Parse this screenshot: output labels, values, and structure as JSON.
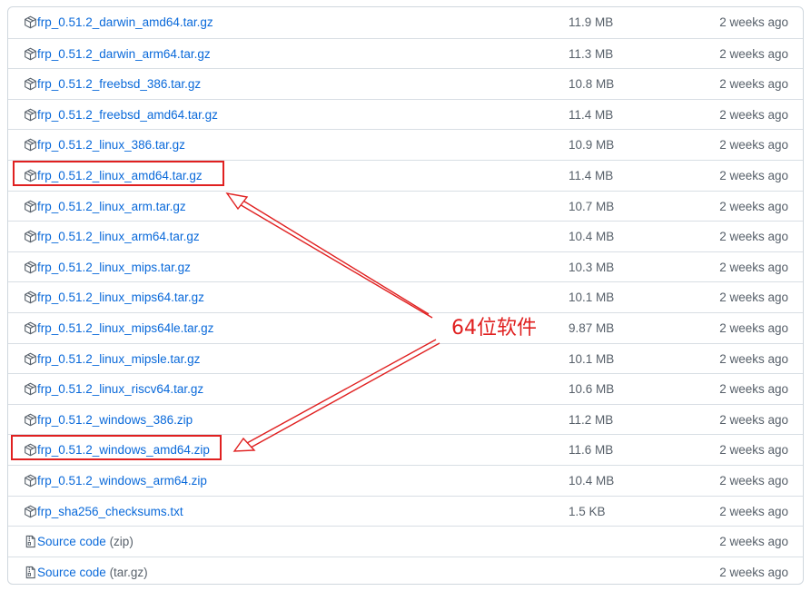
{
  "assets": [
    {
      "name": "frp_0.51.2_darwin_amd64.tar.gz",
      "size": "11.9 MB",
      "date": "2 weeks ago",
      "icon": "package-icon"
    },
    {
      "name": "frp_0.51.2_darwin_arm64.tar.gz",
      "size": "11.3 MB",
      "date": "2 weeks ago",
      "icon": "package-icon"
    },
    {
      "name": "frp_0.51.2_freebsd_386.tar.gz",
      "size": "10.8 MB",
      "date": "2 weeks ago",
      "icon": "package-icon"
    },
    {
      "name": "frp_0.51.2_freebsd_amd64.tar.gz",
      "size": "11.4 MB",
      "date": "2 weeks ago",
      "icon": "package-icon"
    },
    {
      "name": "frp_0.51.2_linux_386.tar.gz",
      "size": "10.9 MB",
      "date": "2 weeks ago",
      "icon": "package-icon"
    },
    {
      "name": "frp_0.51.2_linux_amd64.tar.gz",
      "size": "11.4 MB",
      "date": "2 weeks ago",
      "icon": "package-icon"
    },
    {
      "name": "frp_0.51.2_linux_arm.tar.gz",
      "size": "10.7 MB",
      "date": "2 weeks ago",
      "icon": "package-icon"
    },
    {
      "name": "frp_0.51.2_linux_arm64.tar.gz",
      "size": "10.4 MB",
      "date": "2 weeks ago",
      "icon": "package-icon"
    },
    {
      "name": "frp_0.51.2_linux_mips.tar.gz",
      "size": "10.3 MB",
      "date": "2 weeks ago",
      "icon": "package-icon"
    },
    {
      "name": "frp_0.51.2_linux_mips64.tar.gz",
      "size": "10.1 MB",
      "date": "2 weeks ago",
      "icon": "package-icon"
    },
    {
      "name": "frp_0.51.2_linux_mips64le.tar.gz",
      "size": "9.87 MB",
      "date": "2 weeks ago",
      "icon": "package-icon"
    },
    {
      "name": "frp_0.51.2_linux_mipsle.tar.gz",
      "size": "10.1 MB",
      "date": "2 weeks ago",
      "icon": "package-icon"
    },
    {
      "name": "frp_0.51.2_linux_riscv64.tar.gz",
      "size": "10.6 MB",
      "date": "2 weeks ago",
      "icon": "package-icon"
    },
    {
      "name": "frp_0.51.2_windows_386.zip",
      "size": "11.2 MB",
      "date": "2 weeks ago",
      "icon": "package-icon"
    },
    {
      "name": "frp_0.51.2_windows_amd64.zip",
      "size": "11.6 MB",
      "date": "2 weeks ago",
      "icon": "package-icon"
    },
    {
      "name": "frp_0.51.2_windows_arm64.zip",
      "size": "10.4 MB",
      "date": "2 weeks ago",
      "icon": "package-icon"
    },
    {
      "name": "frp_sha256_checksums.txt",
      "size": "1.5 KB",
      "date": "2 weeks ago",
      "icon": "package-icon"
    },
    {
      "name": "Source code",
      "suffix": "(zip)",
      "size": "",
      "date": "2 weeks ago",
      "icon": "file-zip-icon"
    },
    {
      "name": "Source code",
      "suffix": "(tar.gz)",
      "size": "",
      "date": "2 weeks ago",
      "icon": "file-zip-icon"
    }
  ],
  "highlighted_assets": [
    "frp_0.51.2_linux_amd64.tar.gz",
    "frp_0.51.2_windows_amd64.zip"
  ],
  "annotation": {
    "text": "64位软件"
  },
  "colors": {
    "link": "#0969da",
    "muted": "#57606a",
    "border": "#d0d7de",
    "annotation": "#e02020"
  }
}
